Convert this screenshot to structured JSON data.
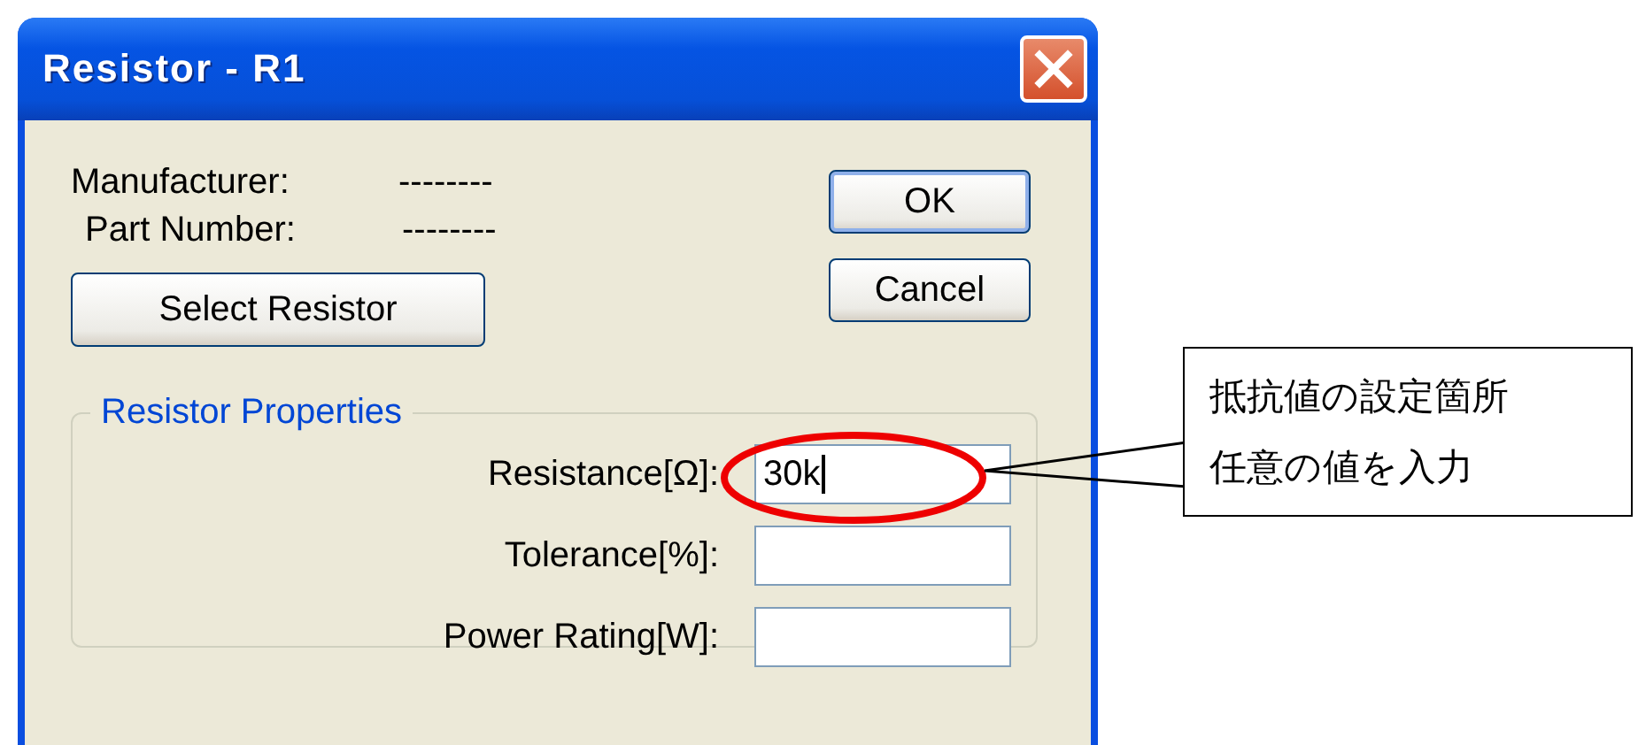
{
  "window": {
    "title": "Resistor - R1"
  },
  "info": [
    {
      "label": "Manufacturer:",
      "value": "--------"
    },
    {
      "label": "Part Number:",
      "value": "--------"
    }
  ],
  "buttons": [
    {
      "label": "OK",
      "default": true
    },
    {
      "label": "Cancel",
      "default": false
    }
  ],
  "select_button": "Select Resistor",
  "group": {
    "title": "Resistor Properties",
    "fields": [
      {
        "label": "Resistance[Ω]:",
        "value": "30k",
        "focused": true
      },
      {
        "label": "Tolerance[%]:",
        "focused": false
      },
      {
        "label": "Power Rating[W]:",
        "focused": false
      }
    ]
  },
  "annotation": {
    "lines": [
      "抵抗値の設定箇所",
      "任意の値を入力"
    ]
  }
}
